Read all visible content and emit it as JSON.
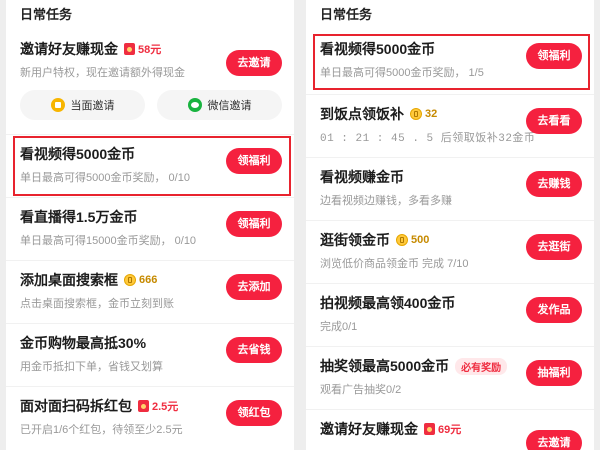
{
  "left": {
    "section_title": "日常任务",
    "invite_friends": {
      "title": "邀请好友赚现金",
      "reward": "58元",
      "desc": "新用户特权，现在邀请额外得现金",
      "button": "去邀请",
      "face_invite": "当面邀请",
      "wechat_invite": "微信邀请"
    },
    "tasks": [
      {
        "title": "看视频得5000金币",
        "desc": "单日最高可得5000金币奖励， 0/10",
        "button": "领福利"
      },
      {
        "title": "看直播得1.5万金币",
        "desc": "单日最高可得15000金币奖励， 0/10",
        "button": "领福利"
      },
      {
        "title": "添加桌面搜索框",
        "reward": "666",
        "desc": "点击桌面搜索框，金币立刻到账",
        "button": "去添加"
      },
      {
        "title": "金币购物最高抵30%",
        "desc": "用金币抵扣下单，省钱又划算",
        "button": "去省钱"
      },
      {
        "title": "面对面扫码拆红包",
        "reward": "2.5元",
        "desc": "已开启1/6个红包，待领至少2.5元",
        "button": "领红包"
      }
    ]
  },
  "right": {
    "section_title": "日常任务",
    "tasks": [
      {
        "title": "看视频得5000金币",
        "desc": "单日最高可得5000金币奖励， 1/5",
        "button": "领福利"
      },
      {
        "title": "到饭点领饭补",
        "reward": "32",
        "desc": "01 : 21 : 45 . 5  后领取饭补32金币",
        "button": "去看看"
      },
      {
        "title": "看视频赚金币",
        "desc": "边看视频边赚钱，多看多赚",
        "button": "去赚钱"
      },
      {
        "title": "逛街领金币",
        "reward": "500",
        "desc": "浏览低价商品领金币 完成 7/10",
        "button": "去逛街"
      },
      {
        "title": "拍视频最高领400金币",
        "desc": "完成0/1",
        "button": "发作品"
      },
      {
        "title": "抽奖领最高5000金币",
        "tag": "必有奖励",
        "desc": "观看广告抽奖0/2",
        "button": "抽福利"
      },
      {
        "title": "邀请好友赚现金",
        "reward": "69元",
        "desc": "",
        "button": "去邀请"
      }
    ]
  },
  "colors": {
    "accent": "#f5213f",
    "highlight_box": "#e8232e",
    "gold": "#ffc93c"
  }
}
